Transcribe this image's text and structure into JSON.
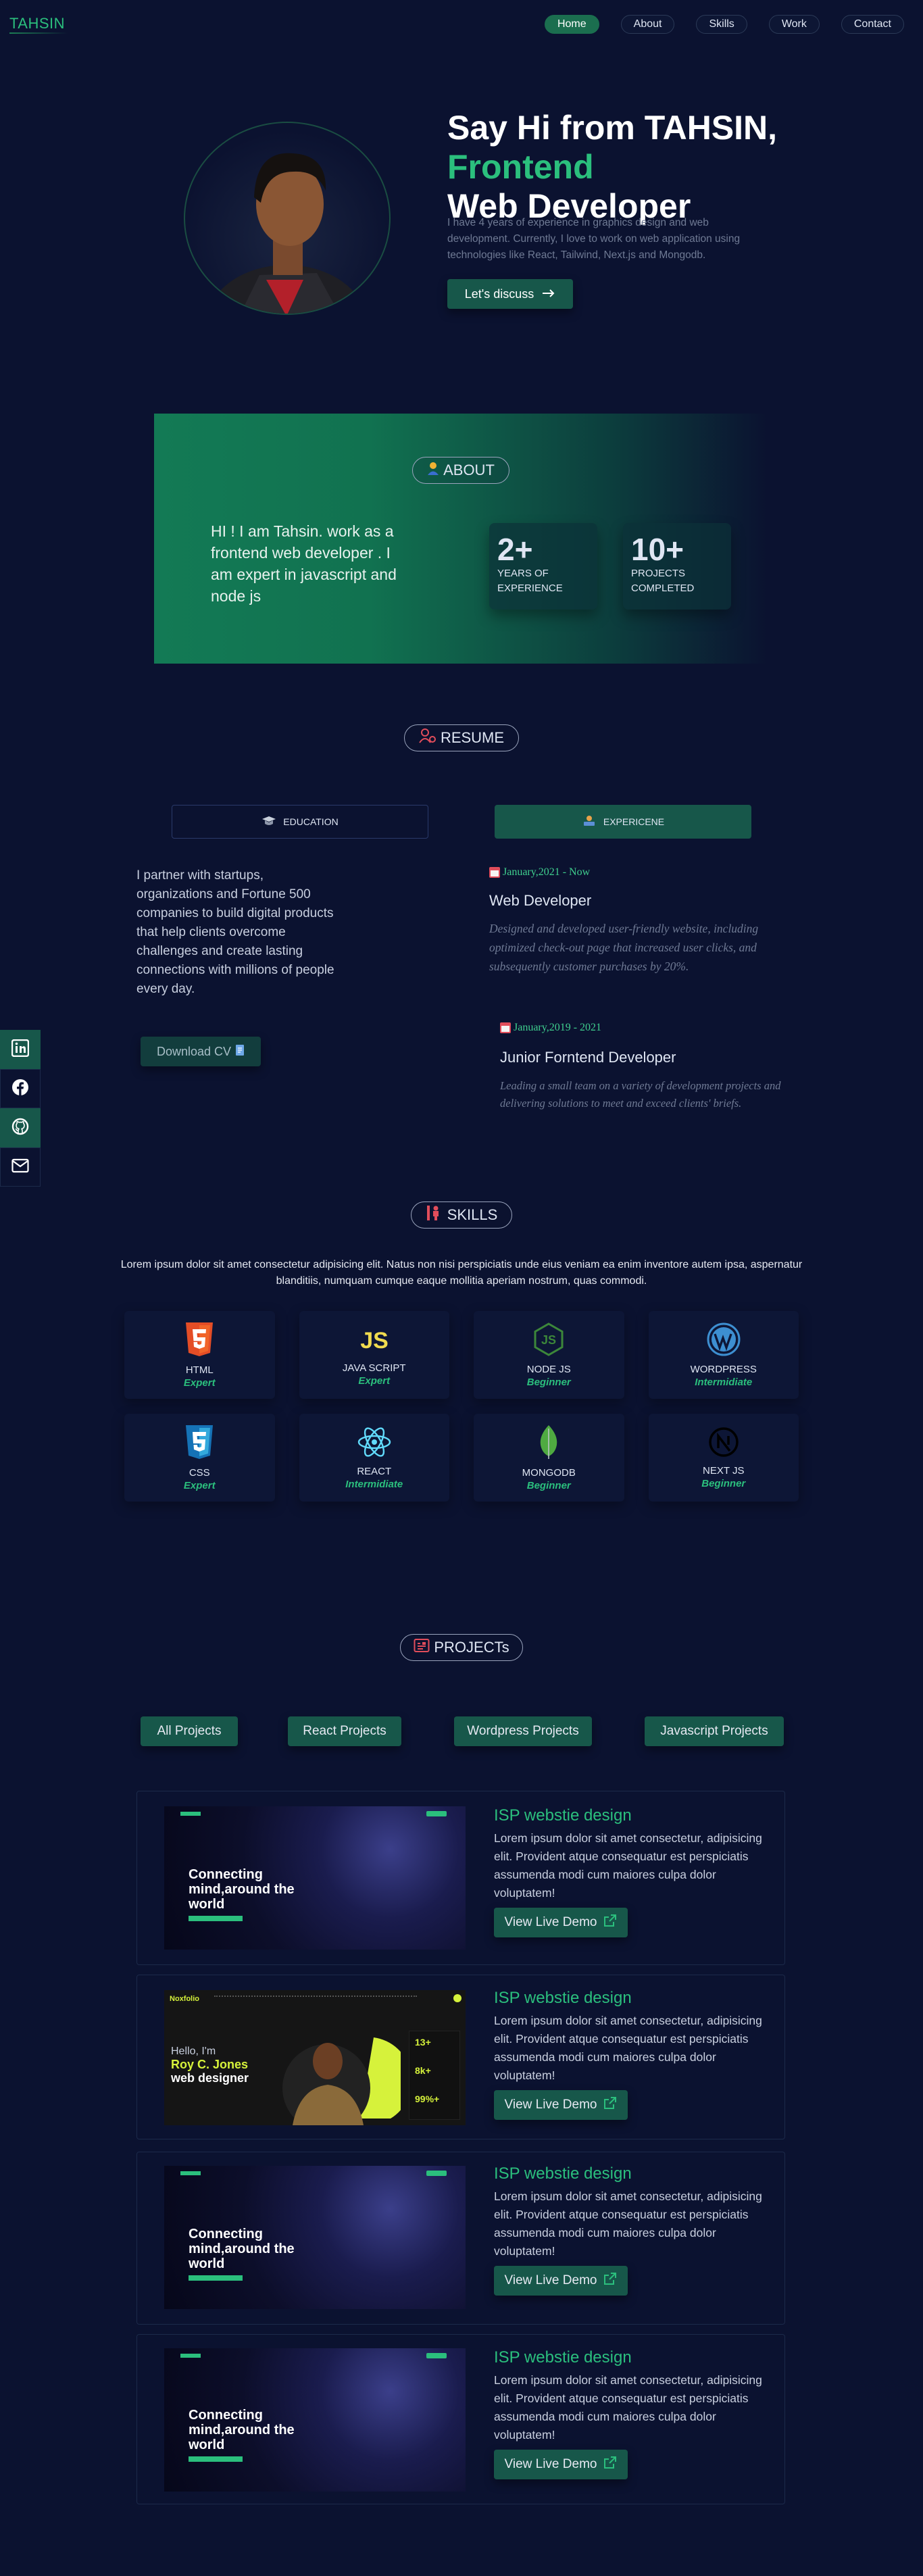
{
  "nav": {
    "logo": "TAHSIN",
    "items": [
      {
        "label": "Home",
        "active": true
      },
      {
        "label": "About",
        "active": false
      },
      {
        "label": "Skills",
        "active": false
      },
      {
        "label": "Work",
        "active": false
      },
      {
        "label": "Contact",
        "active": false
      }
    ]
  },
  "hero": {
    "line1": "Say Hi from TAHSIN,",
    "line2": "Frontend",
    "line3": "Web Developer",
    "description": "I have 4 years of experience in graphics design and web development. Currently, I love to work on web application using technologies like React, Tailwind, Next.js and Mongodb.",
    "cta": "Let's discuss"
  },
  "about": {
    "badge": "ABOUT",
    "text": "HI ! I am Tahsin. work as a frontend web developer . I am expert in javascript and node js",
    "stats": [
      {
        "number": "2+",
        "label": "Years of experience"
      },
      {
        "number": "10+",
        "label": "Projects completed"
      }
    ]
  },
  "resume": {
    "badge": "RESUME",
    "tab_education": "EDUCATION",
    "tab_experience": "EXPERICENE",
    "intro": "I partner with startups, organizations and Fortune 500 companies to build digital products that help clients overcome challenges and create lasting connections with millions of people every day.",
    "download_cv": "Download CV",
    "experiences": [
      {
        "date": "January,2021 - Now",
        "title": "Web Developer",
        "desc": "Designed and developed user-friendly website, including optimized check-out page that increased user clicks, and subsequently customer purchases by 20%."
      },
      {
        "date": "January,2019 - 2021",
        "title": "Junior Forntend Developer",
        "desc": "Leading a small team on a variety of development projects and delivering solutions to meet and exceed clients' briefs."
      }
    ]
  },
  "social": [
    "linkedin-icon",
    "facebook-icon",
    "github-icon",
    "mail-icon"
  ],
  "skills": {
    "badge": "SKILLS",
    "intro": "Lorem ipsum dolor sit amet consectetur adipisicing elit. Natus non nisi perspiciatis unde eius veniam ea enim inventore autem ipsa, aspernatur blanditiis, numquam cumque eaque mollitia aperiam nostrum, quas commodi.",
    "items": [
      {
        "name": "HTML",
        "level": "Expert",
        "icon": "html5-icon",
        "color": "#e44d26"
      },
      {
        "name": "JAVA SCRIPT",
        "level": "Expert",
        "icon": "js-icon",
        "color": "#f0db4f"
      },
      {
        "name": "NODE JS",
        "level": "Beginner",
        "icon": "nodejs-icon",
        "color": "#3c873a"
      },
      {
        "name": "WORDPRESS",
        "level": "Intermidiate",
        "icon": "wordpress-icon",
        "color": "#3d8fd1"
      },
      {
        "name": "CSS",
        "level": "Expert",
        "icon": "css3-icon",
        "color": "#2965f1"
      },
      {
        "name": "REACT",
        "level": "Intermidiate",
        "icon": "react-icon",
        "color": "#61dafb"
      },
      {
        "name": "MONGODB",
        "level": "Beginner",
        "icon": "mongodb-icon",
        "color": "#4faa41"
      },
      {
        "name": "NEXT JS",
        "level": "Beginner",
        "icon": "nextjs-icon",
        "color": "#000000"
      }
    ]
  },
  "projects": {
    "badge": "PROJECTs",
    "filters": [
      "All Projects",
      "React Projects",
      "Wordpress Projects",
      "Javascript Projects"
    ],
    "items": [
      {
        "title": "ISP webstie design",
        "desc": "Lorem ipsum dolor sit amet consectetur, adipisicing elit. Provident atque consequatur est perspiciatis assumenda modi cum maiores culpa dolor voluptatem!",
        "demo": "View Live Demo",
        "mock_heading": "Connecting mind,around the world"
      },
      {
        "title": "ISP webstie design",
        "desc": "Lorem ipsum dolor sit amet consectetur, adipisicing elit. Provident atque consequatur est perspiciatis assumenda modi cum maiores culpa dolor voluptatem!",
        "demo": "View Live Demo",
        "mock_brand": "Noxfolio",
        "mock_hello": "Hello, I'm",
        "mock_name": "Roy C. Jones",
        "mock_role": "web designer",
        "mock_stats": [
          "13+",
          "8k+",
          "99%+"
        ]
      },
      {
        "title": "ISP webstie design",
        "desc": "Lorem ipsum dolor sit amet consectetur, adipisicing elit. Provident atque consequatur est perspiciatis assumenda modi cum maiores culpa dolor voluptatem!",
        "demo": "View Live Demo",
        "mock_heading": "Connecting mind,around the world"
      },
      {
        "title": "ISP webstie design",
        "desc": "Lorem ipsum dolor sit amet consectetur, adipisicing elit. Provident atque consequatur est perspiciatis assumenda modi cum maiores culpa dolor voluptatem!",
        "demo": "View Live Demo",
        "mock_heading": "Connecting mind,around the world"
      }
    ]
  }
}
